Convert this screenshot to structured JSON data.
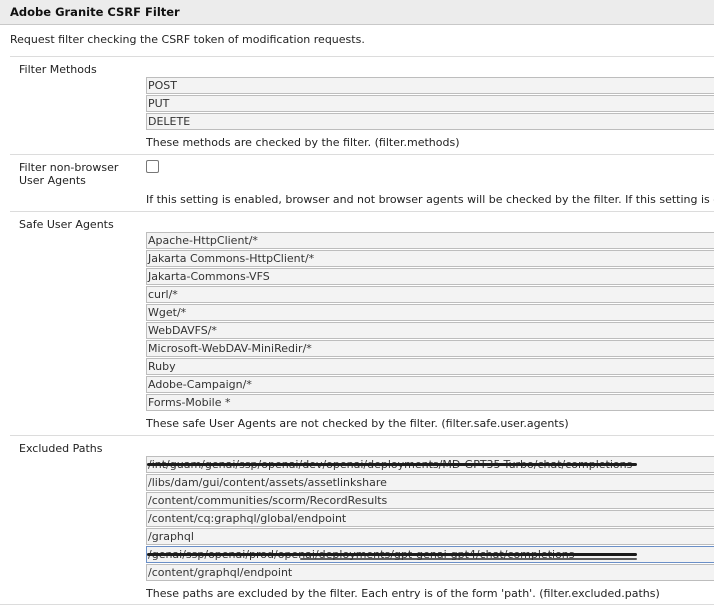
{
  "header": {
    "title": "Adobe Granite CSRF Filter"
  },
  "description": "Request filter checking the CSRF token of modification requests.",
  "filter_methods": {
    "label": "Filter Methods",
    "values": [
      "POST",
      "PUT",
      "DELETE"
    ],
    "help": "These methods are checked by the filter. (filter.methods)"
  },
  "non_browser": {
    "label_line1": "Filter non-browser",
    "label_line2": "User Agents",
    "checked": false,
    "help": "If this setting is enabled, browser and not browser agents will be checked by the filter. If this setting is disabled"
  },
  "safe_user_agents": {
    "label": "Safe User Agents",
    "values": [
      "Apache-HttpClient/*",
      "Jakarta Commons-HttpClient/*",
      "Jakarta-Commons-VFS",
      "curl/*",
      "Wget/*",
      "WebDAVFS/*",
      "Microsoft-WebDAV-MiniRedir/*",
      "Ruby",
      "Adobe-Campaign/*",
      "Forms-Mobile *"
    ],
    "help": "These safe User Agents are not checked by the filter. (filter.safe.user.agents)"
  },
  "excluded_paths": {
    "label": "Excluded Paths",
    "values": [
      "/int/guam/genai/ssp/openai/dev/openai/deployments/MD-GPT35-Turbo/chat/completions",
      "/libs/dam/gui/content/assets/assetlinkshare",
      "/content/communities/scorm/RecordResults",
      "/content/cq:graphql/global/endpoint",
      "/graphql",
      "/genai/ssp/openai/prod/openai/deployments/gpt-genai-gpt4/chat/completions",
      "/content/graphql/endpoint"
    ],
    "help": "These paths are excluded by the filter. Each entry is of the form 'path'. (filter.excluded.paths)"
  }
}
